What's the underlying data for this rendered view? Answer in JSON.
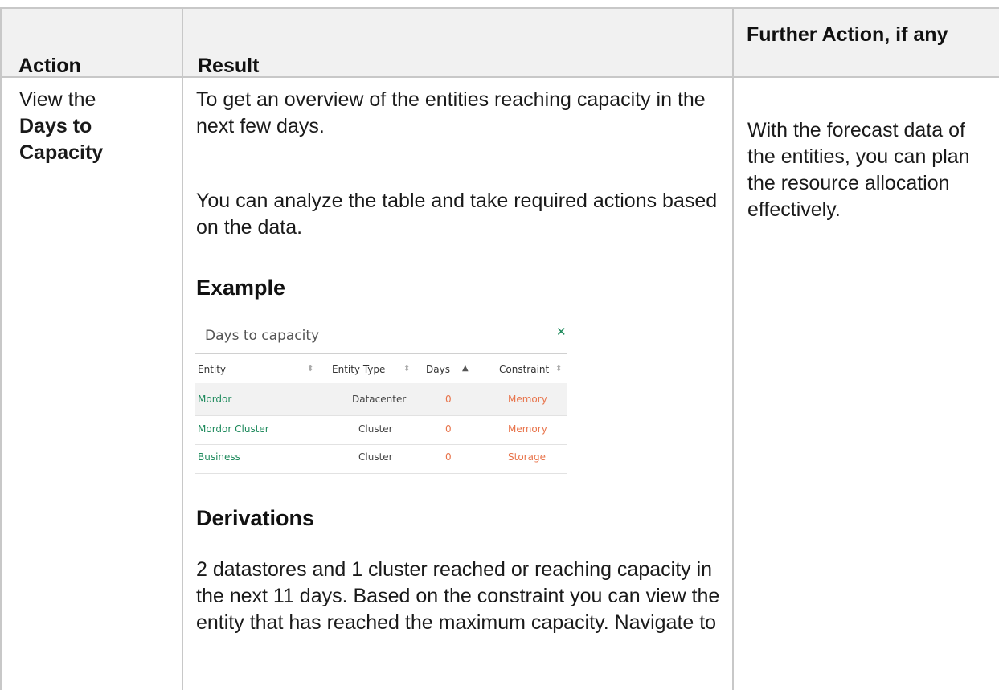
{
  "table": {
    "headers": {
      "action": "Action",
      "result": "Result",
      "further": "Further Action, if any"
    },
    "row": {
      "action": {
        "line1": "View the",
        "bold": "Days to Capacity"
      },
      "result": {
        "para1": "To get an overview of the entities reaching capacity in the next few days.",
        "para2": "You can analyze the table and take required actions based on the data.",
        "example_heading": "Example",
        "derivations_heading": "Derivations",
        "derivations_text": "2 datastores and 1 cluster reached or reaching capacity in the next 11 days. Based on the constraint you can view the entity that has reached the maximum capacity. Navigate to"
      },
      "further": "With the forecast data of the entities, you can plan the resource allocation effectively."
    }
  },
  "widget": {
    "title": "Days to capacity",
    "close_icon": "close-icon",
    "columns": [
      "Entity",
      "Entity Type",
      "Days",
      "Constraint"
    ],
    "sorted_column": "Days",
    "rows": [
      {
        "entity": "Mordor",
        "type": "Datacenter",
        "days": "0",
        "constraint": "Memory"
      },
      {
        "entity": "Mordor Cluster",
        "type": "Cluster",
        "days": "0",
        "constraint": "Memory"
      },
      {
        "entity": "Business",
        "type": "Cluster",
        "days": "0",
        "constraint": "Storage"
      }
    ],
    "colors": {
      "accent_green": "#1e8a5c",
      "value_orange": "#e8734a"
    }
  }
}
